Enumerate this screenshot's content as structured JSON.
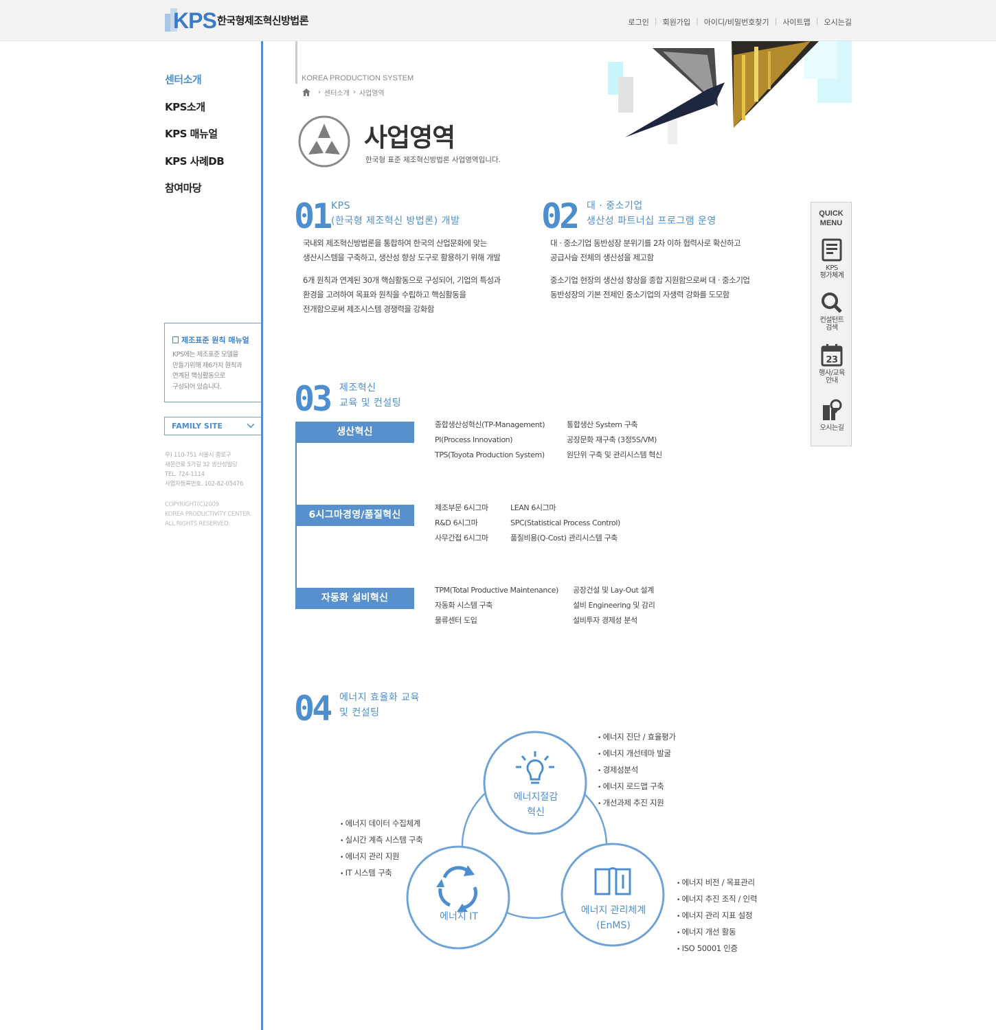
{
  "header": {
    "logo_text": "KPS",
    "logo_title": "한국형제조혁신방법론",
    "util": [
      "로그인",
      "회원가입",
      "아이디/비밀번호찾기",
      "사이트맵",
      "오시는길"
    ]
  },
  "lnb": [
    "센터소개",
    "KPS소개",
    "KPS 매뉴얼",
    "KPS 사례DB",
    "참여마당"
  ],
  "side": {
    "manual_title": "제조표준 원칙 매뉴얼",
    "manual_desc": [
      "KPS에는 제조표준 모델을",
      "만들기위해 제6가지 원칙과",
      "연계된 핵심활동으로",
      "구성되어 있습니다."
    ],
    "family_site": "FAMILY SITE",
    "address": [
      "우) 110-751 서울시 종로구",
      "새문안로 5가길 32 생산성빌딩",
      "TEL. 724-1114",
      "사업자등록번호. 102-82-05476"
    ],
    "copyright": [
      "COPYRIGHT(C)2009",
      "KOREA PRODUCTIVITY CENTER.",
      "ALL RIGHTS RESERVED."
    ]
  },
  "page": {
    "eng": "KOREA PRODUCTION SYSTEM",
    "crumb": [
      "센터소개",
      "사업영역"
    ],
    "title": "사업영역",
    "subtitle": "한국형 표준 제조혁신방법론 사업영역입니다."
  },
  "sections": {
    "s01": {
      "num": "01",
      "title": [
        "KPS",
        "(한국형 제조혁신 방법론) 개발"
      ],
      "body": [
        [
          "국내외 제조혁신방법론을 통합하여 한국의 산업문화에 맞는",
          "생산시스템을 구축하고, 생산성 향상 도구로 활용하기 위해 개발"
        ],
        [
          "6개 원칙과 연계된 30개 핵심활동으로 구성되어, 기업의 특성과",
          "환경을 고려하여 목표와 원칙을 수립하고 핵심활동을",
          "전개함으로써 제조시스템 경쟁력을 강화함"
        ]
      ]
    },
    "s02": {
      "num": "02",
      "title": [
        "대 · 중소기업",
        "생산성 파트너십 프로그램 운영"
      ],
      "body": [
        [
          "대 · 중소기업 동반성장 분위기를 2차 이하 협력사로 확산하고",
          "공급사슬 전체의 생산성을 제고함"
        ],
        [
          "중소기업 현장의 생산성 향상을 종합 지원함으로써 대 · 중소기업",
          "동반성장의 기본 전제인 중소기업의 자생력 강화를 도모함"
        ]
      ]
    },
    "s03": {
      "num": "03",
      "title": [
        "제조혁신",
        "교육 및 컨설팅"
      ],
      "categories": [
        {
          "label": "생산혁신",
          "col1": [
            "종합생산성혁신(TP-Management)",
            "PI(Process Innovation)",
            "TPS(Toyota Production System)"
          ],
          "col2": [
            "통합생산 System 구축",
            "공장문화 재구축 (3정5S/VM)",
            "원단위 구축 및 관리시스템 혁신"
          ]
        },
        {
          "label": "6시그마경영/품질혁신",
          "col1": [
            "제조부문 6시그마",
            "R&D 6시그마",
            "사무간접 6시그마"
          ],
          "col2": [
            "LEAN 6시그마",
            "SPC(Statistical Process Control)",
            "품질비용(Q-Cost) 관리시스템 구축"
          ]
        },
        {
          "label": "자동화 설비혁신",
          "col1": [
            "TPM(Total Productive Maintenance)",
            "자동화 시스템 구축",
            "물류센터 도입"
          ],
          "col2": [
            "공장건설 및 Lay-Out 설계",
            "설비 Engineering 및 감리",
            "설비투자 경제성 분석"
          ]
        }
      ]
    },
    "s04": {
      "num": "04",
      "title": [
        "에너지 효율화 교육",
        "및 컨설팅"
      ],
      "circles": {
        "top": {
          "label": [
            "에너지절감",
            "혁신"
          ],
          "items": [
            "에너지 진단 / 효율평가",
            "에너지 개선테마 발굴",
            "경제성분석",
            "에너지 로드맵 구축",
            "개선과제 추진 지원"
          ]
        },
        "left": {
          "label": [
            "에너지 IT"
          ],
          "items": [
            "에너지 데이터 수집체계",
            "실시간 계측 시스템 구축",
            "에너지 관리 지원",
            "IT 시스템 구축"
          ]
        },
        "right": {
          "label": [
            "에너지 관리체계",
            "(EnMS)"
          ],
          "items": [
            "에너지 비전 / 목표관리",
            "에너지 추진 조직 / 인력",
            "에너지 관리 지표 설정",
            "에너지 개선 활동",
            "ISO 50001 인증"
          ]
        }
      }
    }
  },
  "quick": {
    "title": [
      "QUICK",
      "MENU"
    ],
    "items": [
      {
        "icon": "document-icon",
        "label": [
          "KPS",
          "평가체계"
        ]
      },
      {
        "icon": "search-icon",
        "label": [
          "컨설턴트",
          "검색"
        ]
      },
      {
        "icon": "calendar-icon",
        "label": [
          "행사/교육",
          "안내"
        ],
        "day": "23"
      },
      {
        "icon": "map-icon",
        "label": [
          "오시는길"
        ]
      }
    ]
  },
  "colors": {
    "accent": "#4d8fce",
    "category_bg": "#5790cd"
  }
}
